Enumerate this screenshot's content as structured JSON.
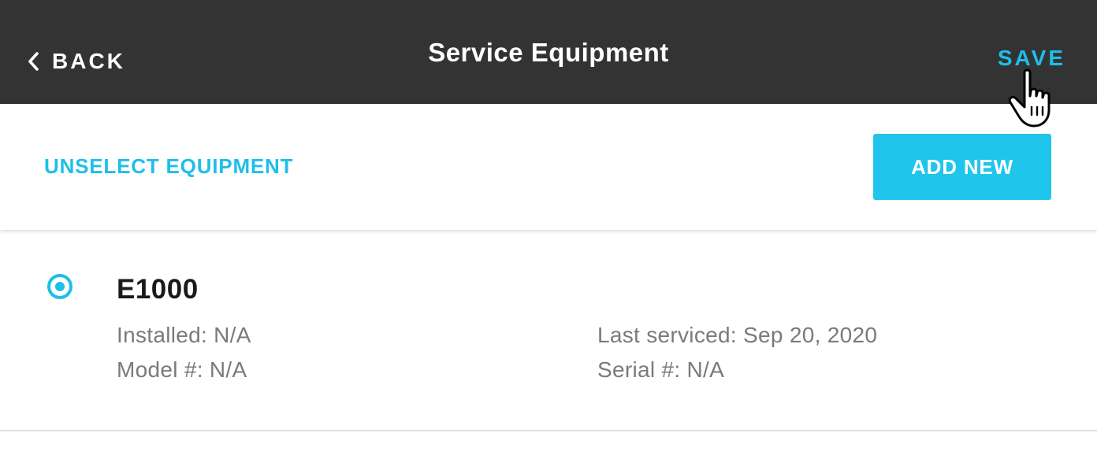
{
  "header": {
    "back_label": "BACK",
    "title": "Service Equipment",
    "save_label": "SAVE"
  },
  "toolbar": {
    "unselect_label": "UNSELECT EQUIPMENT",
    "add_new_label": "ADD NEW"
  },
  "equipment": [
    {
      "name": "E1000",
      "selected": true,
      "installed": "Installed: N/A",
      "model": "Model #: N/A",
      "last_serviced": "Last serviced: Sep 20, 2020",
      "serial": "Serial #: N/A"
    }
  ],
  "icons": {
    "back": "chevron-left-icon",
    "cursor": "hand-pointer-icon",
    "radio": "radio-selected-icon"
  },
  "colors": {
    "header_bg": "#333333",
    "accent": "#1ebfe8",
    "button_bg": "#20c5ec",
    "text_dark": "#1a1a1a",
    "text_muted": "#7a7a7a"
  }
}
